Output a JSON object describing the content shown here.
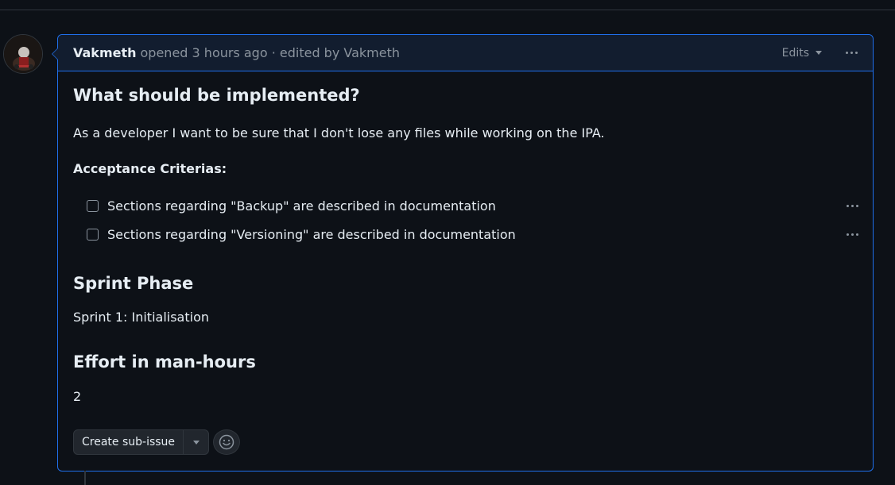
{
  "comment": {
    "author": "Vakmeth",
    "meta": "opened 3 hours ago · edited by Vakmeth",
    "edits_label": "Edits",
    "menu_icon": "kebab-horizontal-icon"
  },
  "body": {
    "heading_what": "What should be implemented?",
    "description": "As a developer I want to be sure that I don't lose any files while working on the IPA.",
    "acceptance_label": "Acceptance Criterias:",
    "tasks": [
      {
        "text": "Sections regarding \"Backup\" are described in documentation",
        "checked": false
      },
      {
        "text": "Sections regarding \"Versioning\" are described in documentation",
        "checked": false
      }
    ],
    "heading_sprint": "Sprint Phase",
    "sprint_value": "Sprint 1: Initialisation",
    "heading_effort": "Effort in man-hours",
    "effort_value": "2"
  },
  "actions": {
    "create_subissue_label": "Create sub-issue",
    "emoji_icon": "smiley-icon",
    "caret_icon": "triangle-down-icon"
  },
  "colors": {
    "background": "#0d1117",
    "header_bg": "#121d2f",
    "accent_border": "#1f6feb",
    "muted_text": "#8b949e",
    "text": "#e6edf3"
  }
}
